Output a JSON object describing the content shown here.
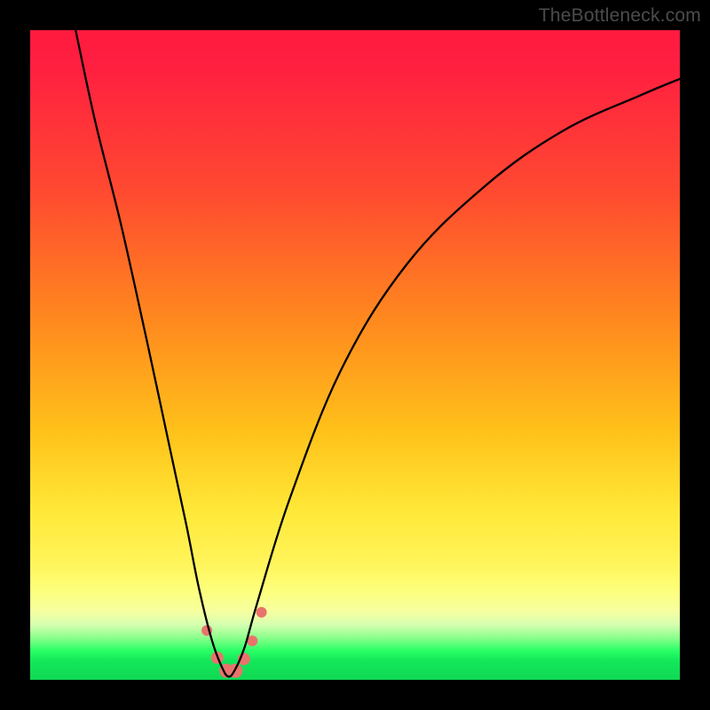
{
  "watermark": "TheBottleneck.com",
  "chart_data": {
    "type": "line",
    "title": "",
    "xlabel": "",
    "ylabel": "",
    "xlim": [
      0,
      100
    ],
    "ylim": [
      0,
      100
    ],
    "series": [
      {
        "name": "bottleneck-curve",
        "x": [
          7,
          10,
          14,
          18,
          21,
          24,
          26,
          28,
          29.5,
          30.5,
          31.5,
          33,
          35,
          40,
          48,
          58,
          70,
          82,
          94,
          100
        ],
        "y": [
          100,
          86,
          70,
          52,
          38,
          24,
          14,
          6,
          2,
          0.5,
          1.5,
          5,
          12,
          28,
          48,
          64,
          76,
          84.5,
          90,
          92.5
        ]
      }
    ],
    "markers": {
      "name": "highlight-dots",
      "color": "#e9736c",
      "points": [
        {
          "x": 27.2,
          "y": 7.6,
          "r": 6
        },
        {
          "x": 28.8,
          "y": 3.4,
          "r": 7
        },
        {
          "x": 30.2,
          "y": 1.4,
          "r": 8
        },
        {
          "x": 31.6,
          "y": 1.4,
          "r": 8
        },
        {
          "x": 32.9,
          "y": 3.2,
          "r": 7
        },
        {
          "x": 34.2,
          "y": 6.0,
          "r": 6
        },
        {
          "x": 35.6,
          "y": 10.4,
          "r": 6
        }
      ]
    },
    "background_gradient": {
      "stops": [
        {
          "pos": 0,
          "color": "#ff1a3e"
        },
        {
          "pos": 0.45,
          "color": "#ff8a1e"
        },
        {
          "pos": 0.78,
          "color": "#ffe838"
        },
        {
          "pos": 0.93,
          "color": "#8cff8c"
        },
        {
          "pos": 1.0,
          "color": "#0fd854"
        }
      ]
    }
  }
}
